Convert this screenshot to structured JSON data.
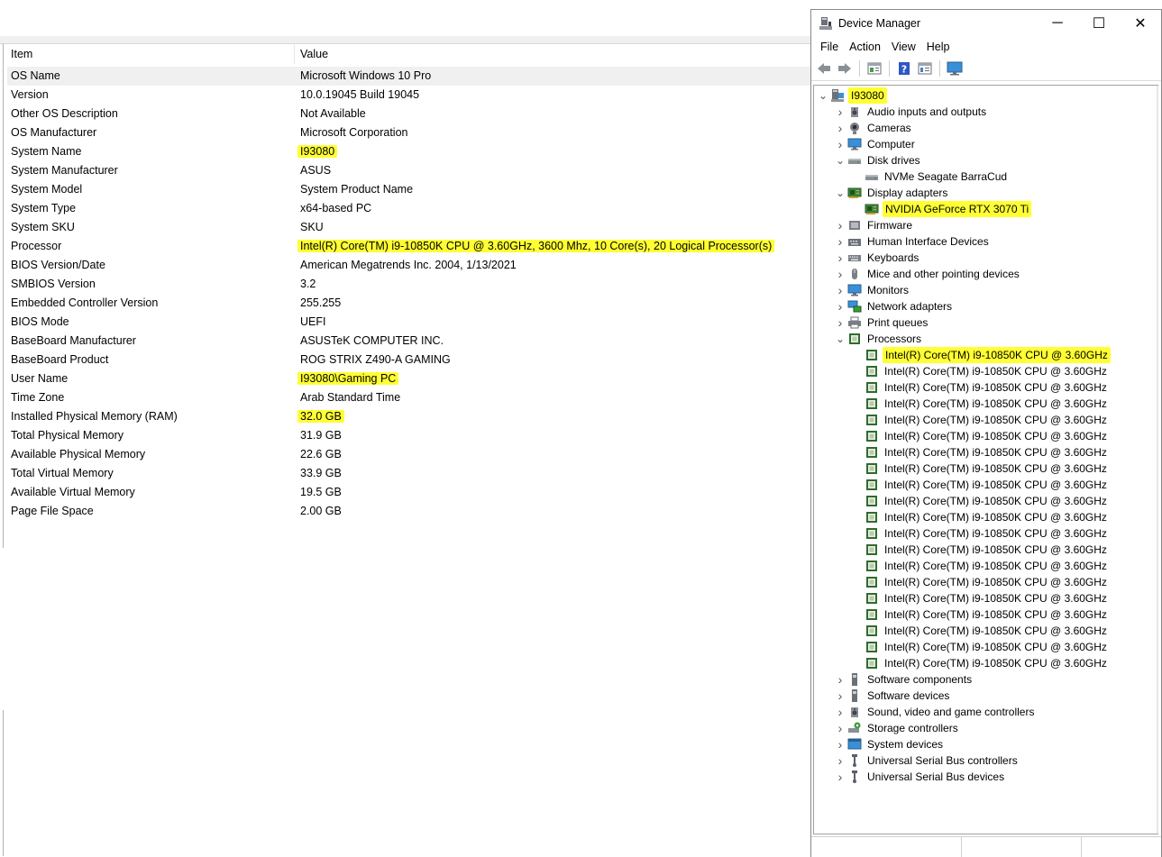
{
  "sysinfo": {
    "header": {
      "item": "Item",
      "value": "Value"
    },
    "rows": [
      {
        "item": "OS Name",
        "value": "Microsoft Windows 10 Pro",
        "highlight": false
      },
      {
        "item": "Version",
        "value": "10.0.19045 Build 19045",
        "highlight": false
      },
      {
        "item": "Other OS Description",
        "value": "Not Available",
        "highlight": false
      },
      {
        "item": "OS Manufacturer",
        "value": "Microsoft Corporation",
        "highlight": false
      },
      {
        "item": "System Name",
        "value": "I93080",
        "highlight": true
      },
      {
        "item": "System Manufacturer",
        "value": "ASUS",
        "highlight": false
      },
      {
        "item": "System Model",
        "value": "System Product Name",
        "highlight": false
      },
      {
        "item": "System Type",
        "value": "x64-based PC",
        "highlight": false
      },
      {
        "item": "System SKU",
        "value": "SKU",
        "highlight": false
      },
      {
        "item": "Processor",
        "value": "Intel(R) Core(TM) i9-10850K CPU @ 3.60GHz, 3600 Mhz, 10 Core(s), 20 Logical Processor(s)",
        "highlight": true
      },
      {
        "item": "BIOS Version/Date",
        "value": "American Megatrends Inc. 2004, 1/13/2021",
        "highlight": false
      },
      {
        "item": "SMBIOS Version",
        "value": "3.2",
        "highlight": false
      },
      {
        "item": "Embedded Controller Version",
        "value": "255.255",
        "highlight": false
      },
      {
        "item": "BIOS Mode",
        "value": "UEFI",
        "highlight": false
      },
      {
        "item": "BaseBoard Manufacturer",
        "value": "ASUSTeK COMPUTER INC.",
        "highlight": false
      },
      {
        "item": "BaseBoard Product",
        "value": "ROG STRIX Z490-A GAMING",
        "highlight": false
      },
      {
        "item": "User Name",
        "value": "I93080\\Gaming PC",
        "highlight": true
      },
      {
        "item": "Time Zone",
        "value": "Arab Standard Time",
        "highlight": false
      },
      {
        "item": "Installed Physical Memory (RAM)",
        "value": "32.0 GB",
        "highlight": true
      },
      {
        "item": "Total Physical Memory",
        "value": "31.9 GB",
        "highlight": false
      },
      {
        "item": "Available Physical Memory",
        "value": "22.6 GB",
        "highlight": false
      },
      {
        "item": "Total Virtual Memory",
        "value": "33.9 GB",
        "highlight": false
      },
      {
        "item": "Available Virtual Memory",
        "value": "19.5 GB",
        "highlight": false
      },
      {
        "item": "Page File Space",
        "value": "2.00 GB",
        "highlight": false
      }
    ]
  },
  "devmgr": {
    "title": "Device Manager",
    "window_buttons": {
      "minimize": "─",
      "maximize": "☐",
      "close": "✕"
    },
    "menu": [
      "File",
      "Action",
      "View",
      "Help"
    ],
    "toolbar": [
      "back-icon",
      "forward-icon",
      "properties-icon",
      "help-icon",
      "details-icon",
      "monitor-icon"
    ],
    "highlight_color": "#ffff33",
    "tree": [
      {
        "label": "I93080",
        "level": 0,
        "expander": "open",
        "icon": "computer-icon",
        "highlight": true
      },
      {
        "label": "Audio inputs and outputs",
        "level": 1,
        "expander": "closed",
        "icon": "speaker-icon",
        "highlight": false
      },
      {
        "label": "Cameras",
        "level": 1,
        "expander": "closed",
        "icon": "camera-icon",
        "highlight": false
      },
      {
        "label": "Computer",
        "level": 1,
        "expander": "closed",
        "icon": "monitor-icon",
        "highlight": false
      },
      {
        "label": "Disk drives",
        "level": 1,
        "expander": "open",
        "icon": "disk-icon",
        "highlight": false
      },
      {
        "label": "NVMe Seagate BarraCud",
        "level": 2,
        "expander": "none",
        "icon": "disk-icon",
        "highlight": false
      },
      {
        "label": "Display adapters",
        "level": 1,
        "expander": "open",
        "icon": "display-adapter-icon",
        "highlight": false
      },
      {
        "label": "NVIDIA GeForce RTX 3070 Ti",
        "level": 2,
        "expander": "none",
        "icon": "display-adapter-icon",
        "highlight": true
      },
      {
        "label": "Firmware",
        "level": 1,
        "expander": "closed",
        "icon": "firmware-icon",
        "highlight": false
      },
      {
        "label": "Human Interface Devices",
        "level": 1,
        "expander": "closed",
        "icon": "hid-icon",
        "highlight": false
      },
      {
        "label": "Keyboards",
        "level": 1,
        "expander": "closed",
        "icon": "keyboard-icon",
        "highlight": false
      },
      {
        "label": "Mice and other pointing devices",
        "level": 1,
        "expander": "closed",
        "icon": "mouse-icon",
        "highlight": false
      },
      {
        "label": "Monitors",
        "level": 1,
        "expander": "closed",
        "icon": "monitor-icon",
        "highlight": false
      },
      {
        "label": "Network adapters",
        "level": 1,
        "expander": "closed",
        "icon": "network-icon",
        "highlight": false
      },
      {
        "label": "Print queues",
        "level": 1,
        "expander": "closed",
        "icon": "printer-icon",
        "highlight": false
      },
      {
        "label": "Processors",
        "level": 1,
        "expander": "open",
        "icon": "processor-icon",
        "highlight": false
      },
      {
        "label": "Intel(R) Core(TM) i9-10850K CPU @ 3.60GHz",
        "level": 2,
        "expander": "none",
        "icon": "processor-icon",
        "highlight": true
      },
      {
        "label": "Intel(R) Core(TM) i9-10850K CPU @ 3.60GHz",
        "level": 2,
        "expander": "none",
        "icon": "processor-icon",
        "highlight": false
      },
      {
        "label": "Intel(R) Core(TM) i9-10850K CPU @ 3.60GHz",
        "level": 2,
        "expander": "none",
        "icon": "processor-icon",
        "highlight": false
      },
      {
        "label": "Intel(R) Core(TM) i9-10850K CPU @ 3.60GHz",
        "level": 2,
        "expander": "none",
        "icon": "processor-icon",
        "highlight": false
      },
      {
        "label": "Intel(R) Core(TM) i9-10850K CPU @ 3.60GHz",
        "level": 2,
        "expander": "none",
        "icon": "processor-icon",
        "highlight": false
      },
      {
        "label": "Intel(R) Core(TM) i9-10850K CPU @ 3.60GHz",
        "level": 2,
        "expander": "none",
        "icon": "processor-icon",
        "highlight": false
      },
      {
        "label": "Intel(R) Core(TM) i9-10850K CPU @ 3.60GHz",
        "level": 2,
        "expander": "none",
        "icon": "processor-icon",
        "highlight": false
      },
      {
        "label": "Intel(R) Core(TM) i9-10850K CPU @ 3.60GHz",
        "level": 2,
        "expander": "none",
        "icon": "processor-icon",
        "highlight": false
      },
      {
        "label": "Intel(R) Core(TM) i9-10850K CPU @ 3.60GHz",
        "level": 2,
        "expander": "none",
        "icon": "processor-icon",
        "highlight": false
      },
      {
        "label": "Intel(R) Core(TM) i9-10850K CPU @ 3.60GHz",
        "level": 2,
        "expander": "none",
        "icon": "processor-icon",
        "highlight": false
      },
      {
        "label": "Intel(R) Core(TM) i9-10850K CPU @ 3.60GHz",
        "level": 2,
        "expander": "none",
        "icon": "processor-icon",
        "highlight": false
      },
      {
        "label": "Intel(R) Core(TM) i9-10850K CPU @ 3.60GHz",
        "level": 2,
        "expander": "none",
        "icon": "processor-icon",
        "highlight": false
      },
      {
        "label": "Intel(R) Core(TM) i9-10850K CPU @ 3.60GHz",
        "level": 2,
        "expander": "none",
        "icon": "processor-icon",
        "highlight": false
      },
      {
        "label": "Intel(R) Core(TM) i9-10850K CPU @ 3.60GHz",
        "level": 2,
        "expander": "none",
        "icon": "processor-icon",
        "highlight": false
      },
      {
        "label": "Intel(R) Core(TM) i9-10850K CPU @ 3.60GHz",
        "level": 2,
        "expander": "none",
        "icon": "processor-icon",
        "highlight": false
      },
      {
        "label": "Intel(R) Core(TM) i9-10850K CPU @ 3.60GHz",
        "level": 2,
        "expander": "none",
        "icon": "processor-icon",
        "highlight": false
      },
      {
        "label": "Intel(R) Core(TM) i9-10850K CPU @ 3.60GHz",
        "level": 2,
        "expander": "none",
        "icon": "processor-icon",
        "highlight": false
      },
      {
        "label": "Intel(R) Core(TM) i9-10850K CPU @ 3.60GHz",
        "level": 2,
        "expander": "none",
        "icon": "processor-icon",
        "highlight": false
      },
      {
        "label": "Intel(R) Core(TM) i9-10850K CPU @ 3.60GHz",
        "level": 2,
        "expander": "none",
        "icon": "processor-icon",
        "highlight": false
      },
      {
        "label": "Intel(R) Core(TM) i9-10850K CPU @ 3.60GHz",
        "level": 2,
        "expander": "none",
        "icon": "processor-icon",
        "highlight": false
      },
      {
        "label": "Software components",
        "level": 1,
        "expander": "closed",
        "icon": "software-component-icon",
        "highlight": false
      },
      {
        "label": "Software devices",
        "level": 1,
        "expander": "closed",
        "icon": "software-device-icon",
        "highlight": false
      },
      {
        "label": "Sound, video and game controllers",
        "level": 1,
        "expander": "closed",
        "icon": "speaker-icon",
        "highlight": false
      },
      {
        "label": "Storage controllers",
        "level": 1,
        "expander": "closed",
        "icon": "storage-controller-icon",
        "highlight": false
      },
      {
        "label": "System devices",
        "level": 1,
        "expander": "closed",
        "icon": "system-devices-icon",
        "highlight": false
      },
      {
        "label": "Universal Serial Bus controllers",
        "level": 1,
        "expander": "closed",
        "icon": "usb-icon",
        "highlight": false
      },
      {
        "label": "Universal Serial Bus devices",
        "level": 1,
        "expander": "closed",
        "icon": "usb-icon",
        "highlight": false
      }
    ]
  }
}
